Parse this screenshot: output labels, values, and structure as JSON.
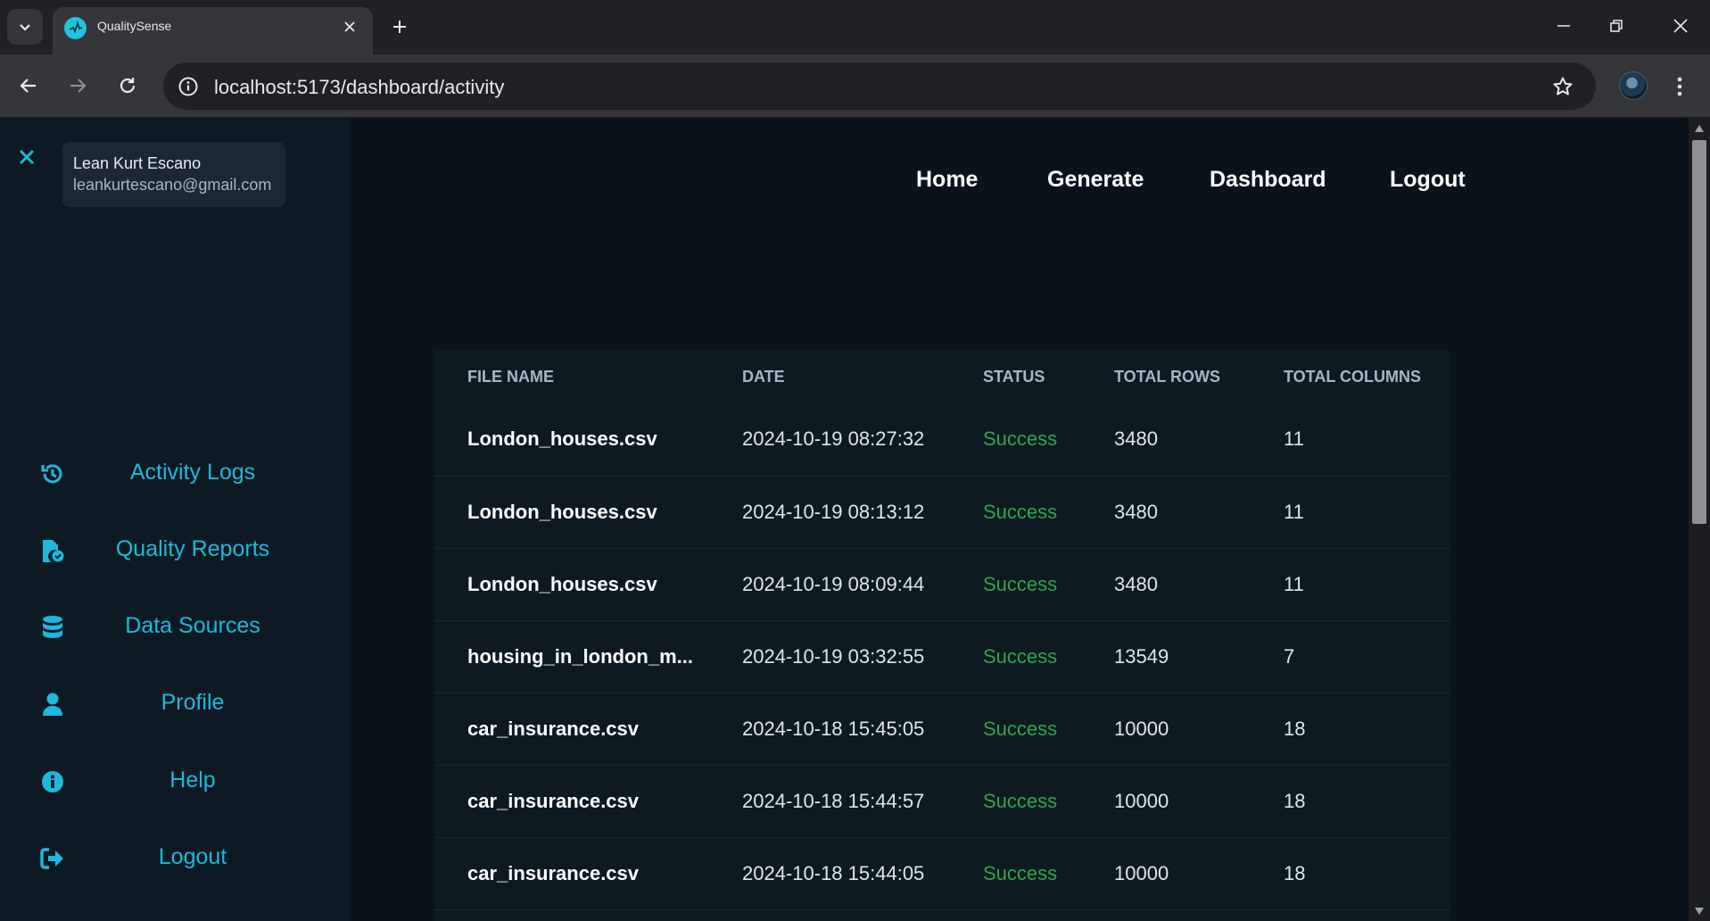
{
  "browser": {
    "tab_title": "QualitySense",
    "url": "localhost:5173/dashboard/activity"
  },
  "sidebar": {
    "user_name": "Lean Kurt Escano",
    "user_email": "leankurtescano@gmail.com",
    "items": [
      {
        "label": "Activity Logs",
        "icon": "history-icon"
      },
      {
        "label": "Quality Reports",
        "icon": "file-check-icon"
      },
      {
        "label": "Data Sources",
        "icon": "database-icon"
      },
      {
        "label": "Profile",
        "icon": "user-icon"
      },
      {
        "label": "Help",
        "icon": "info-icon"
      },
      {
        "label": "Logout",
        "icon": "sign-out-icon"
      }
    ]
  },
  "nav": {
    "home": "Home",
    "generate": "Generate",
    "dashboard": "Dashboard",
    "logout": "Logout"
  },
  "table": {
    "headers": [
      "FILE NAME",
      "DATE",
      "STATUS",
      "TOTAL ROWS",
      "TOTAL COLUMNS"
    ],
    "rows": [
      [
        "London_houses.csv",
        "2024-10-19 08:27:32",
        "Success",
        "3480",
        "11"
      ],
      [
        "London_houses.csv",
        "2024-10-19 08:13:12",
        "Success",
        "3480",
        "11"
      ],
      [
        "London_houses.csv",
        "2024-10-19 08:09:44",
        "Success",
        "3480",
        "11"
      ],
      [
        "housing_in_london_m...",
        "2024-10-19 03:32:55",
        "Success",
        "13549",
        "7"
      ],
      [
        "car_insurance.csv",
        "2024-10-18 15:45:05",
        "Success",
        "10000",
        "18"
      ],
      [
        "car_insurance.csv",
        "2024-10-18 15:44:57",
        "Success",
        "10000",
        "18"
      ],
      [
        "car_insurance.csv",
        "2024-10-18 15:44:05",
        "Success",
        "10000",
        "18"
      ]
    ]
  },
  "colors": {
    "accent": "#1fb7dc",
    "success": "#2ea84a",
    "sidebar_bg": "#0e1a23",
    "page_bg": "#0a121b"
  }
}
